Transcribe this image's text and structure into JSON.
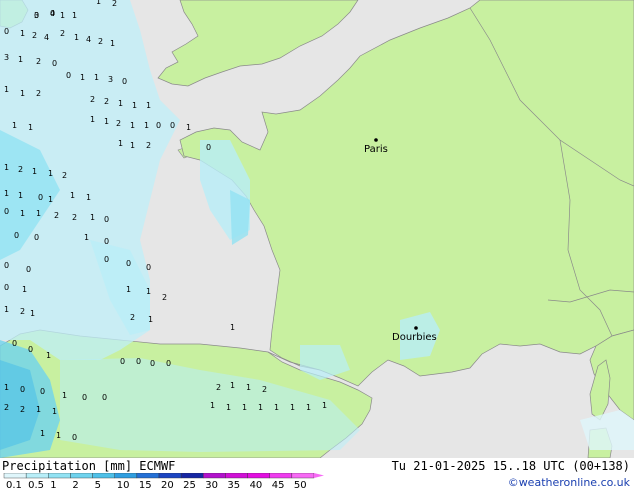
{
  "map": {
    "cities": [
      {
        "name": "Paris"
      },
      {
        "name": "Dourbies"
      }
    ],
    "precip_numbers": [
      "3",
      "4",
      "1",
      "1",
      "1",
      "2",
      "0",
      "1",
      "2",
      "4",
      "2",
      "1",
      "4",
      "2",
      "1",
      "3",
      "1",
      "2",
      "0",
      "0",
      "1",
      "1",
      "3",
      "0",
      "1",
      "1",
      "2",
      "2",
      "2",
      "1",
      "1",
      "1",
      "1",
      "1",
      "1",
      "1",
      "2",
      "1",
      "1",
      "0",
      "0",
      "1",
      "0",
      "1",
      "1",
      "2",
      "1",
      "2",
      "1",
      "1",
      "2",
      "1",
      "1",
      "0",
      "1",
      "1",
      "1",
      "0",
      "1",
      "1",
      "2",
      "2",
      "1",
      "0",
      "0",
      "0",
      "1",
      "0",
      "0",
      "0",
      "0",
      "0",
      "0",
      "0",
      "1",
      "1",
      "1",
      "2",
      "1",
      "2",
      "1",
      "2",
      "1",
      "1",
      "0",
      "0",
      "1",
      "0",
      "0",
      "0",
      "0",
      "1",
      "0",
      "0",
      "1",
      "0",
      "0",
      "2",
      "1",
      "1",
      "2",
      "2",
      "2",
      "1",
      "1",
      "1",
      "1",
      "1",
      "1",
      "1",
      "1",
      "1",
      "1",
      "1",
      "1",
      "0",
      "0",
      "0"
    ]
  },
  "legend": {
    "title": "Precipitation [mm] ECMWF",
    "date": "Tu 21-01-2025 15..18 UTC (00+138)",
    "credit": "©weatheronline.co.uk",
    "scale": [
      "0.1",
      "0.5",
      "1",
      "2",
      "5",
      "10",
      "15",
      "20",
      "25",
      "30",
      "35",
      "40",
      "45",
      "50"
    ],
    "colors": [
      "#dff6fb",
      "#b8eef8",
      "#92e2f3",
      "#6fd3ee",
      "#4ec0e8",
      "#2f9ee0",
      "#2470d6",
      "#1c45c2",
      "#1626a3",
      "#b212cc",
      "#d010d6",
      "#e20ee0",
      "#ef3cef",
      "#f76af5"
    ]
  }
}
